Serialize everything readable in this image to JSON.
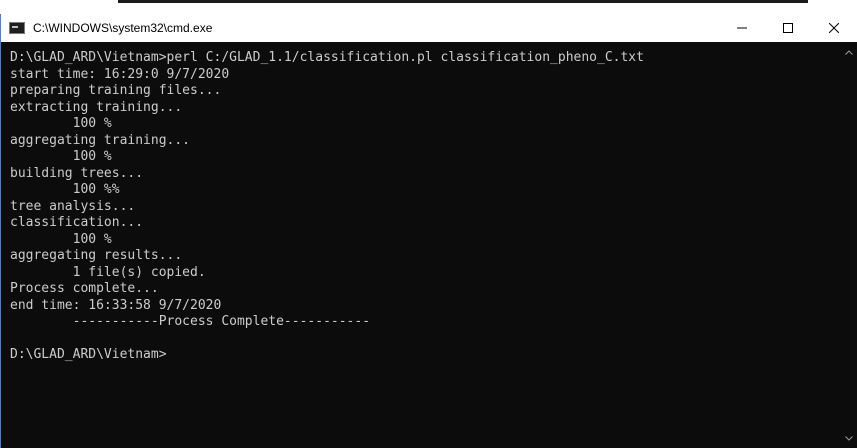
{
  "window": {
    "title": "C:\\WINDOWS\\system32\\cmd.exe",
    "icon": "cmd-icon"
  },
  "controls": {
    "minimize_icon": "minimize-icon",
    "maximize_icon": "maximize-icon",
    "close_icon": "close-icon"
  },
  "console": {
    "lines": [
      "D:\\GLAD_ARD\\Vietnam>perl C:/GLAD_1.1/classification.pl classification_pheno_C.txt",
      "start time: 16:29:0 9/7/2020",
      "preparing training files...",
      "extracting training...",
      "        100 %",
      "aggregating training...",
      "        100 %",
      "building trees...",
      "        100 %%",
      "tree analysis...",
      "classification...",
      "        100 %",
      "aggregating results...",
      "        1 file(s) copied.",
      "Process complete...",
      "end time: 16:33:58 9/7/2020",
      "        -----------Process Complete-----------",
      "",
      "D:\\GLAD_ARD\\Vietnam>"
    ]
  },
  "colors": {
    "console_bg": "#0c0c0c",
    "console_text": "#cccccc",
    "titlebar_bg": "#ffffff"
  }
}
